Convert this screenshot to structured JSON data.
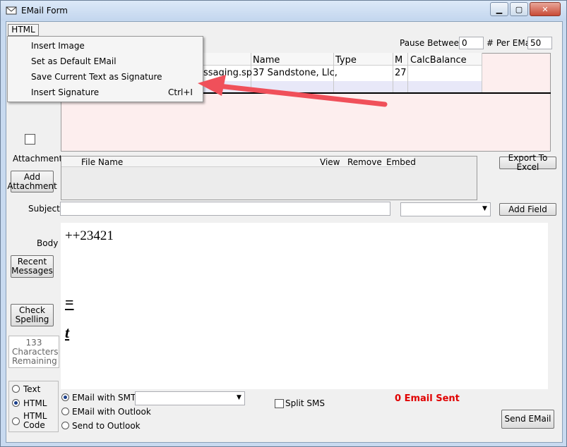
{
  "window": {
    "title": "EMail Form"
  },
  "menu": {
    "html_label": "HTML",
    "items": [
      {
        "label": "Insert Image",
        "shortcut": ""
      },
      {
        "label": "Set as Default EMail",
        "shortcut": ""
      },
      {
        "label": "Save Current Text as Signature",
        "shortcut": ""
      },
      {
        "label": "Insert Signature",
        "shortcut": "Ctrl+I"
      }
    ]
  },
  "top_controls": {
    "pause_between_label": "Pause Between",
    "pause_between_value": "0",
    "per_email_label": "# Per EMail",
    "per_email_value": "50"
  },
  "recipients_grid": {
    "columns": [
      "Name",
      "Type",
      "M",
      "CalcBalance"
    ],
    "row": {
      "partial": "ssaging.sp",
      "name": "37 Sandstone, Llc,",
      "type": "",
      "m": "27",
      "calc": ""
    }
  },
  "attachments": {
    "label": "Attachments",
    "add_button": "Add Attachment",
    "columns": [
      "File Name",
      "View",
      "Remove",
      "Embed"
    ],
    "export_button": "Export To Excel"
  },
  "subject": {
    "label": "Subject",
    "value": "",
    "add_field_button": "Add Field"
  },
  "body": {
    "label": "Body",
    "line1": "++23421",
    "line2": "=",
    "line3": "t",
    "recent_button": "Recent Messages",
    "spell_button": "Check Spelling",
    "chars_remaining": "133 Characters Remaining"
  },
  "format_options": {
    "items": [
      "Text",
      "HTML",
      "HTML Code"
    ],
    "selected": "HTML"
  },
  "send_options": {
    "items": [
      "EMail with SMTP",
      "EMail with Outlook",
      "Send to Outlook"
    ],
    "selected": "EMail with SMTP",
    "smtp_select_value": ""
  },
  "split_sms_label": "Split SMS",
  "status": {
    "sent_text": "0 Email Sent",
    "sent_color": "#e00000"
  },
  "send_button": "Send EMail",
  "colors": {
    "annotation_arrow": "#f0505a",
    "grid_background": "#fdeeee"
  }
}
